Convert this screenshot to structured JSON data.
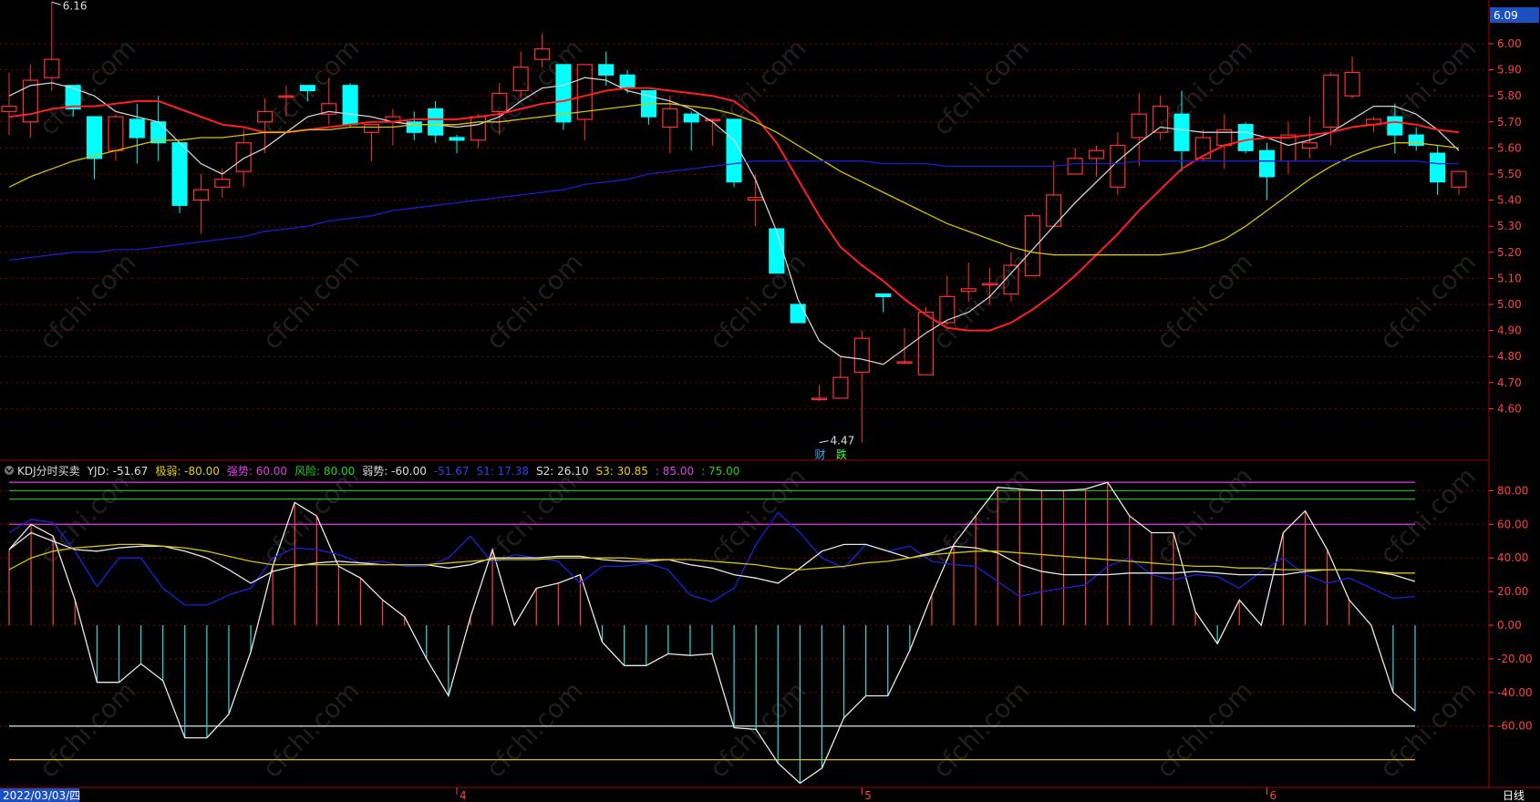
{
  "chart_data": [
    {
      "type": "candlestick",
      "ylim": [
        4.47,
        6.16
      ],
      "y_ticks": [
        6.0,
        5.9,
        5.8,
        5.7,
        5.6,
        5.5,
        5.4,
        5.3,
        5.2,
        5.1,
        5.0,
        4.9,
        4.8,
        4.7,
        4.6
      ],
      "last_price_label": "6.09",
      "high_annotation": {
        "label": "6.16",
        "value": 6.16,
        "bar": 2
      },
      "low_annotation": {
        "label": "4.47",
        "value": 4.47,
        "bar": 38
      },
      "event_markers": [
        {
          "label": "财",
          "bar": 38
        },
        {
          "label": "跌",
          "bar": 39
        }
      ],
      "candles": [
        [
          5.74,
          5.76,
          5.65,
          5.89
        ],
        [
          5.7,
          5.86,
          5.64,
          5.92
        ],
        [
          5.87,
          5.94,
          5.82,
          6.16
        ],
        [
          5.84,
          5.75,
          5.72,
          5.84
        ],
        [
          5.72,
          5.56,
          5.48,
          5.72
        ],
        [
          5.59,
          5.72,
          5.55,
          5.73
        ],
        [
          5.71,
          5.64,
          5.54,
          5.77
        ],
        [
          5.7,
          5.62,
          5.55,
          5.8
        ],
        [
          5.62,
          5.38,
          5.35,
          5.62
        ],
        [
          5.4,
          5.44,
          5.27,
          5.5
        ],
        [
          5.45,
          5.48,
          5.41,
          5.52
        ],
        [
          5.51,
          5.62,
          5.45,
          5.67
        ],
        [
          5.7,
          5.74,
          5.58,
          5.79
        ],
        [
          5.8,
          5.8,
          5.72,
          5.84
        ],
        [
          5.84,
          5.82,
          5.78,
          5.84
        ],
        [
          5.73,
          5.77,
          5.69,
          5.87
        ],
        [
          5.84,
          5.69,
          5.68,
          5.85
        ],
        [
          5.66,
          5.69,
          5.55,
          5.69
        ],
        [
          5.7,
          5.72,
          5.61,
          5.75
        ],
        [
          5.7,
          5.66,
          5.63,
          5.74
        ],
        [
          5.75,
          5.65,
          5.62,
          5.78
        ],
        [
          5.64,
          5.63,
          5.58,
          5.65
        ],
        [
          5.63,
          5.72,
          5.6,
          5.73
        ],
        [
          5.74,
          5.81,
          5.65,
          5.85
        ],
        [
          5.82,
          5.91,
          5.79,
          5.97
        ],
        [
          5.94,
          5.98,
          5.91,
          6.04
        ],
        [
          5.92,
          5.7,
          5.67,
          5.92
        ],
        [
          5.71,
          5.92,
          5.63,
          5.92
        ],
        [
          5.92,
          5.88,
          5.84,
          5.97
        ],
        [
          5.88,
          5.83,
          5.81,
          5.9
        ],
        [
          5.82,
          5.72,
          5.69,
          5.82
        ],
        [
          5.68,
          5.75,
          5.58,
          5.8
        ],
        [
          5.73,
          5.7,
          5.59,
          5.74
        ],
        [
          5.71,
          5.71,
          5.61,
          5.71
        ],
        [
          5.71,
          5.47,
          5.45,
          5.71
        ],
        [
          5.4,
          5.41,
          5.3,
          5.5
        ],
        [
          5.29,
          5.12,
          5.12,
          5.29
        ],
        [
          5.0,
          4.93,
          4.93,
          5.0
        ],
        [
          4.64,
          4.64,
          4.63,
          4.69
        ],
        [
          4.64,
          4.72,
          4.64,
          4.8
        ],
        [
          4.74,
          4.87,
          4.47,
          4.9
        ],
        [
          5.04,
          5.03,
          4.97,
          5.04
        ],
        [
          4.78,
          4.78,
          4.77,
          4.91
        ],
        [
          4.73,
          4.97,
          4.73,
          4.99
        ],
        [
          4.93,
          5.03,
          4.92,
          5.11
        ],
        [
          5.05,
          5.06,
          5.01,
          5.16
        ],
        [
          5.08,
          5.08,
          5.0,
          5.14
        ],
        [
          5.04,
          5.15,
          5.01,
          5.2
        ],
        [
          5.11,
          5.34,
          5.11,
          5.35
        ],
        [
          5.3,
          5.42,
          5.3,
          5.55
        ],
        [
          5.5,
          5.56,
          5.5,
          5.6
        ],
        [
          5.56,
          5.59,
          5.49,
          5.61
        ],
        [
          5.45,
          5.61,
          5.42,
          5.66
        ],
        [
          5.64,
          5.73,
          5.53,
          5.81
        ],
        [
          5.66,
          5.76,
          5.63,
          5.8
        ],
        [
          5.73,
          5.59,
          5.51,
          5.82
        ],
        [
          5.56,
          5.64,
          5.55,
          5.67
        ],
        [
          5.61,
          5.67,
          5.52,
          5.73
        ],
        [
          5.69,
          5.59,
          5.58,
          5.7
        ],
        [
          5.59,
          5.49,
          5.4,
          5.62
        ],
        [
          5.55,
          5.65,
          5.5,
          5.7
        ],
        [
          5.6,
          5.62,
          5.56,
          5.72
        ],
        [
          5.68,
          5.88,
          5.61,
          5.89
        ],
        [
          5.8,
          5.89,
          5.79,
          5.95
        ],
        [
          5.69,
          5.71,
          5.66,
          5.72
        ],
        [
          5.72,
          5.65,
          5.58,
          5.77
        ],
        [
          5.65,
          5.61,
          5.59,
          5.68
        ],
        [
          5.58,
          5.47,
          5.42,
          5.61
        ],
        [
          5.45,
          5.51,
          5.42,
          5.51
        ]
      ],
      "series": [
        {
          "name": "",
          "color": "#d0d0d0",
          "values": [
            5.8,
            5.84,
            5.85,
            5.83,
            5.8,
            5.74,
            5.72,
            5.7,
            5.62,
            5.54,
            5.5,
            5.56,
            5.6,
            5.66,
            5.72,
            5.74,
            5.73,
            5.72,
            5.7,
            5.69,
            5.69,
            5.68,
            5.69,
            5.72,
            5.78,
            5.83,
            5.84,
            5.87,
            5.86,
            5.82,
            5.8,
            5.78,
            5.75,
            5.7,
            5.63,
            5.48,
            5.28,
            5.02,
            4.86,
            4.8,
            4.79,
            4.77,
            4.83,
            4.89,
            4.94,
            4.97,
            5.03,
            5.12,
            5.21,
            5.3,
            5.39,
            5.47,
            5.55,
            5.62,
            5.68,
            5.67,
            5.66,
            5.66,
            5.66,
            5.64,
            5.61,
            5.63,
            5.66,
            5.71,
            5.76,
            5.76,
            5.73,
            5.67,
            5.59
          ]
        },
        {
          "name": "",
          "color": "#ff2020",
          "values": [
            5.72,
            5.73,
            5.75,
            5.76,
            5.76,
            5.77,
            5.78,
            5.78,
            5.75,
            5.72,
            5.69,
            5.68,
            5.66,
            5.66,
            5.67,
            5.68,
            5.69,
            5.7,
            5.7,
            5.71,
            5.71,
            5.71,
            5.72,
            5.73,
            5.75,
            5.77,
            5.78,
            5.8,
            5.82,
            5.83,
            5.83,
            5.82,
            5.81,
            5.8,
            5.78,
            5.72,
            5.62,
            5.48,
            5.34,
            5.22,
            5.15,
            5.09,
            5.02,
            4.96,
            4.91,
            4.9,
            4.9,
            4.93,
            4.98,
            5.04,
            5.11,
            5.19,
            5.27,
            5.36,
            5.44,
            5.52,
            5.57,
            5.61,
            5.63,
            5.64,
            5.64,
            5.65,
            5.66,
            5.68,
            5.69,
            5.7,
            5.69,
            5.67,
            5.66
          ]
        },
        {
          "name": "",
          "color": "#d4c400",
          "values": [
            5.45,
            5.49,
            5.52,
            5.55,
            5.57,
            5.59,
            5.61,
            5.63,
            5.63,
            5.64,
            5.64,
            5.65,
            5.66,
            5.66,
            5.67,
            5.67,
            5.68,
            5.68,
            5.68,
            5.69,
            5.69,
            5.69,
            5.7,
            5.7,
            5.71,
            5.72,
            5.73,
            5.74,
            5.75,
            5.76,
            5.77,
            5.77,
            5.76,
            5.75,
            5.73,
            5.7,
            5.66,
            5.61,
            5.56,
            5.51,
            5.47,
            5.43,
            5.39,
            5.35,
            5.31,
            5.28,
            5.25,
            5.22,
            5.2,
            5.19,
            5.19,
            5.19,
            5.19,
            5.19,
            5.19,
            5.2,
            5.22,
            5.25,
            5.3,
            5.36,
            5.42,
            5.48,
            5.53,
            5.57,
            5.6,
            5.62,
            5.62,
            5.61,
            5.6
          ]
        },
        {
          "name": "",
          "color": "#1c1ccc",
          "values": [
            5.17,
            5.18,
            5.19,
            5.2,
            5.2,
            5.21,
            5.21,
            5.22,
            5.23,
            5.24,
            5.25,
            5.26,
            5.28,
            5.29,
            5.3,
            5.32,
            5.33,
            5.34,
            5.36,
            5.37,
            5.38,
            5.39,
            5.4,
            5.41,
            5.42,
            5.43,
            5.44,
            5.46,
            5.47,
            5.48,
            5.5,
            5.51,
            5.52,
            5.53,
            5.54,
            5.55,
            5.55,
            5.55,
            5.55,
            5.55,
            5.55,
            5.54,
            5.54,
            5.54,
            5.53,
            5.53,
            5.53,
            5.53,
            5.53,
            5.53,
            5.54,
            5.54,
            5.54,
            5.55,
            5.55,
            5.55,
            5.55,
            5.55,
            5.55,
            5.55,
            5.55,
            5.55,
            5.55,
            5.55,
            5.55,
            5.55,
            5.55,
            5.54,
            5.54
          ]
        }
      ]
    },
    {
      "type": "indicator",
      "legend": [
        {
          "text": "KDJ分时买卖",
          "color": "#dddddd"
        },
        {
          "text": "YJD: -51.67",
          "color": "#dddddd"
        },
        {
          "text": "极弱: -80.00",
          "color": "#e6d200"
        },
        {
          "text": "强势: 60.00",
          "color": "#e040e0"
        },
        {
          "text": "风险: 80.00",
          "color": "#20d020"
        },
        {
          "text": "弱势: -60.00",
          "color": "#dddddd"
        },
        {
          "text": "-51.67",
          "color": "#3a3ae8"
        },
        {
          "text": "S1: 17.38",
          "color": "#3a3ae8"
        },
        {
          "text": "S2: 26.10",
          "color": "#dddddd"
        },
        {
          "text": "S3: 30.85",
          "color": "#e6d200"
        },
        {
          "text": ": 85.00",
          "color": "#e040e0"
        },
        {
          "text": ": 75.00",
          "color": "#20d020"
        }
      ],
      "ylim": [
        -95,
        95
      ],
      "y_ticks": [
        80,
        60,
        40,
        20,
        0,
        -20,
        -40,
        -60
      ],
      "reference_lines": [
        {
          "value": 85,
          "color": "#cc33cc"
        },
        {
          "value": 80,
          "color": "#20b020"
        },
        {
          "value": 75,
          "color": "#20b020"
        },
        {
          "value": 60,
          "color": "#cc33cc"
        },
        {
          "value": -60,
          "color": "#cccccc"
        },
        {
          "value": -80,
          "color": "#d4c400"
        }
      ],
      "histogram": [
        45,
        60,
        53,
        15,
        -34,
        -34,
        -23,
        -33,
        -67,
        -67,
        -53,
        -16,
        35,
        73,
        65,
        35,
        28,
        15,
        5,
        -20,
        -42,
        5,
        45,
        0,
        22,
        25,
        30,
        -10,
        -24,
        -24,
        -17,
        -18,
        -17,
        -61,
        -62,
        -82,
        -94,
        -85,
        -55,
        -42,
        -42,
        -15,
        18,
        48,
        65,
        82,
        81,
        80,
        80,
        81,
        85,
        65,
        55,
        55,
        8,
        -11,
        15,
        0,
        55,
        68,
        45,
        15,
        0,
        -40,
        -51
      ],
      "series": [
        {
          "name": "YJD",
          "color": "#e8e8e8",
          "values": [
            45,
            60,
            53,
            15,
            -34,
            -34,
            -23,
            -33,
            -67,
            -67,
            -53,
            -16,
            35,
            73,
            65,
            35,
            28,
            15,
            5,
            -20,
            -42,
            5,
            45,
            0,
            22,
            25,
            30,
            -10,
            -24,
            -24,
            -17,
            -18,
            -17,
            -61,
            -62,
            -82,
            -94,
            -85,
            -55,
            -42,
            -42,
            -15,
            18,
            48,
            65,
            82,
            81,
            80,
            80,
            81,
            85,
            65,
            55,
            55,
            8,
            -11,
            15,
            0,
            55,
            68,
            45,
            15,
            0,
            -40,
            -51
          ]
        },
        {
          "name": "S1",
          "color": "#2020dd",
          "values": [
            55,
            63,
            61,
            44,
            23,
            40,
            40,
            22,
            12,
            12,
            18,
            22,
            40,
            46,
            45,
            42,
            37,
            38,
            35,
            35,
            40,
            53,
            37,
            42,
            40,
            38,
            25,
            35,
            35,
            37,
            33,
            18,
            14,
            22,
            48,
            67,
            55,
            40,
            34,
            48,
            44,
            47,
            38,
            36,
            35,
            26,
            17,
            20,
            22,
            24,
            35,
            40,
            30,
            27,
            30,
            29,
            22,
            32,
            40,
            30,
            25,
            28,
            22,
            16,
            17
          ]
        },
        {
          "name": "S2",
          "color": "#e8e8e8",
          "values": [
            45,
            55,
            50,
            45,
            44,
            46,
            47,
            47,
            44,
            40,
            33,
            25,
            32,
            35,
            37,
            38,
            37,
            36,
            36,
            36,
            34,
            36,
            40,
            40,
            40,
            41,
            41,
            39,
            38,
            38,
            39,
            36,
            34,
            30,
            28,
            25,
            34,
            44,
            48,
            48,
            44,
            40,
            43,
            47,
            46,
            43,
            36,
            32,
            30,
            30,
            30,
            31,
            31,
            31,
            32,
            31,
            30,
            30,
            30,
            32,
            33,
            33,
            32,
            30,
            26
          ]
        },
        {
          "name": "S3",
          "color": "#d4c400",
          "values": [
            33,
            40,
            44,
            46,
            47,
            48,
            48,
            47,
            46,
            44,
            41,
            38,
            36,
            36,
            36,
            36,
            36,
            36,
            36,
            36,
            37,
            38,
            39,
            39,
            39,
            40,
            40,
            40,
            40,
            39,
            39,
            39,
            38,
            37,
            36,
            34,
            33,
            34,
            35,
            37,
            38,
            40,
            42,
            43,
            44,
            44,
            43,
            42,
            41,
            40,
            39,
            38,
            37,
            36,
            35,
            35,
            34,
            34,
            33,
            33,
            33,
            33,
            32,
            31,
            31
          ]
        }
      ]
    }
  ],
  "x_axis": {
    "date_label": "2022/03/03/四",
    "month_labels": [
      {
        "text": "4",
        "bar": 21
      },
      {
        "text": "5",
        "bar": 40
      },
      {
        "text": "6",
        "bar": 59
      }
    ],
    "period_label": "日线"
  },
  "watermark_text": "cfchi.com",
  "colors": {
    "up": "#ff3030",
    "down": "#00ffff",
    "grid": "#8a0000",
    "axis_text": "#ff4040",
    "background": "#000000"
  }
}
